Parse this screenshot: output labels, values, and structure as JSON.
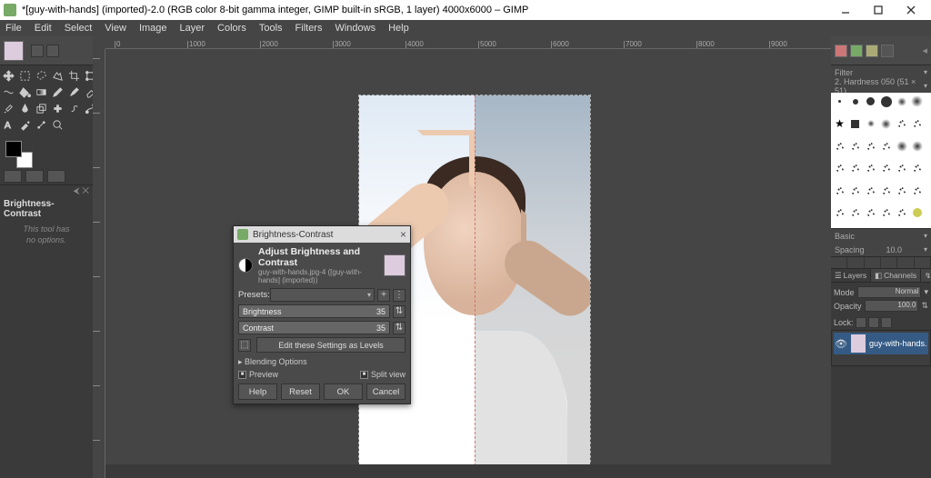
{
  "window": {
    "title": "*[guy-with-hands] (imported)-2.0 (RGB color 8-bit gamma integer, GIMP built-in sRGB, 1 layer) 4000x6000 – GIMP"
  },
  "menubar": [
    "File",
    "Edit",
    "Select",
    "View",
    "Image",
    "Layer",
    "Colors",
    "Tools",
    "Filters",
    "Windows",
    "Help"
  ],
  "toolbox": {
    "tools": [
      "move",
      "rect-select",
      "free-select",
      "fuzzy-select",
      "crop",
      "rotate",
      "scale",
      "flip",
      "perspective",
      "warp",
      "bucket",
      "gradient",
      "pencil",
      "brush",
      "eraser",
      "airbrush",
      "clone",
      "heal",
      "smudge",
      "dodge",
      "path",
      "text",
      "measure",
      "color-picker",
      "zoom"
    ]
  },
  "tool_options": {
    "title": "Brightness-Contrast",
    "msg_line1": "This tool has",
    "msg_line2": "no options."
  },
  "dialog": {
    "titlebar": "Brightness-Contrast",
    "header_title": "Adjust Brightness and Contrast",
    "header_sub": "guy-with-hands.jpg-4 ([guy-with-hands] (imported))",
    "presets_label": "Presets:",
    "brightness_label": "Brightness",
    "brightness_value": "35",
    "contrast_label": "Contrast",
    "contrast_value": "35",
    "edit_levels": "Edit these Settings as Levels",
    "blending": "▸ Blending Options",
    "preview": "Preview",
    "splitview": "Split view",
    "buttons": {
      "help": "Help",
      "reset": "Reset",
      "ok": "OK",
      "cancel": "Cancel"
    }
  },
  "right": {
    "brush_label": "2. Hardness 050 (51 × 51)",
    "basic": "Basic",
    "spacing": "Spacing",
    "spacing_val": "10.0",
    "tabs": {
      "layers": "Layers",
      "channels": "Channels",
      "paths": "Paths"
    },
    "mode_label": "Mode",
    "mode_value": "Normal",
    "opacity_label": "Opacity",
    "opacity_value": "100.0",
    "lock_label": "Lock:",
    "layer_name": "guy-with-hands."
  },
  "ruler_ticks": [
    "0",
    "1000",
    "2000",
    "3000",
    "4000",
    "5000",
    "6000",
    "7000",
    "8000",
    "9000"
  ]
}
